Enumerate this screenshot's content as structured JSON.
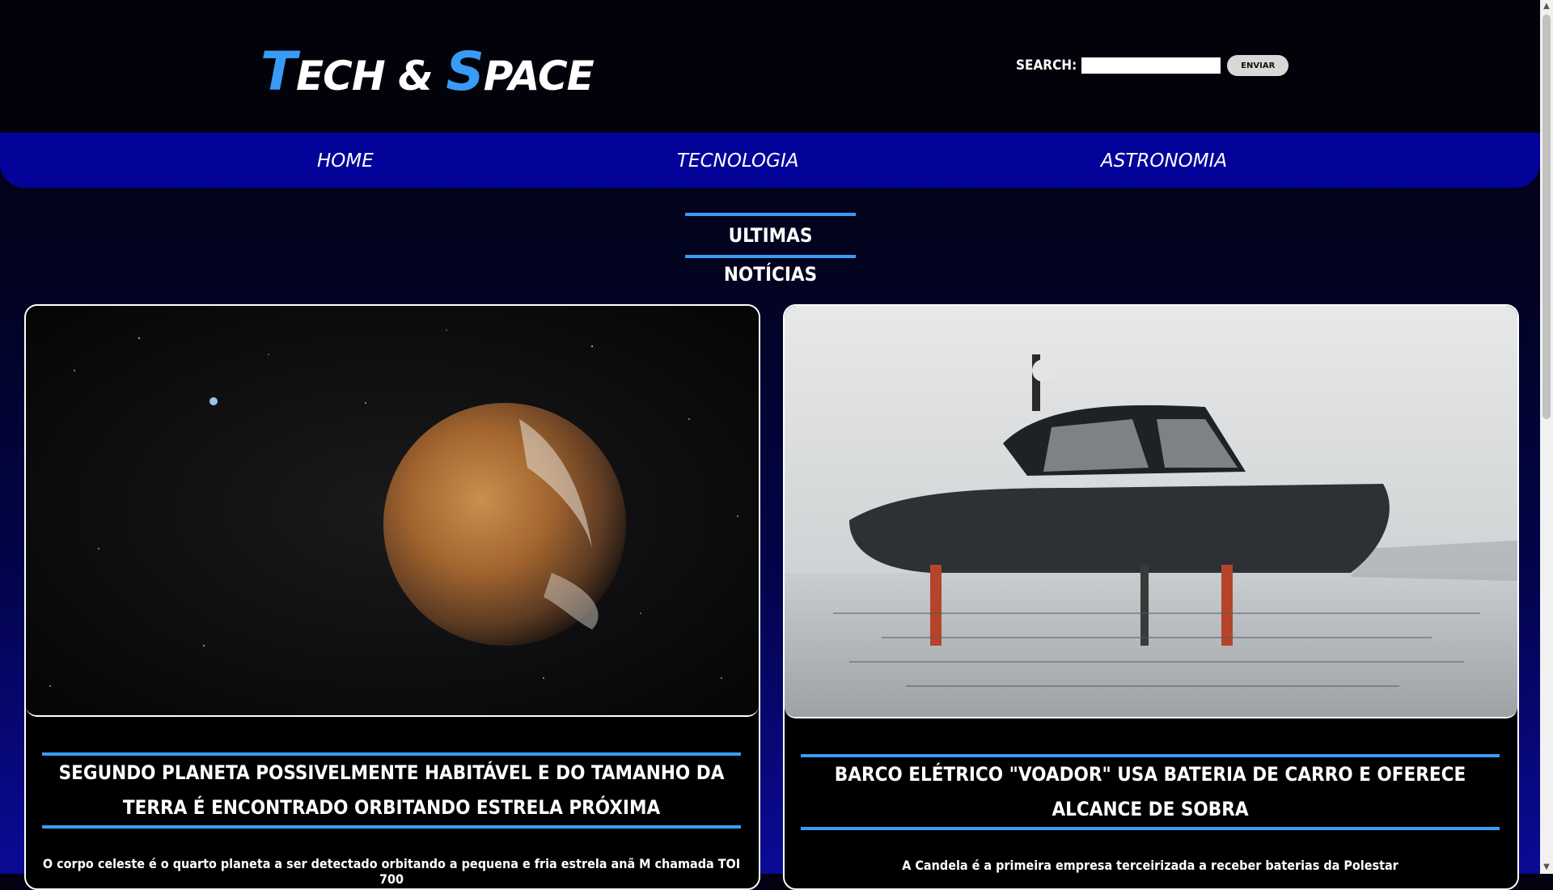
{
  "brand": {
    "logo_t": "T",
    "logo_ech": "ECH",
    "logo_amp": "&",
    "logo_s": "S",
    "logo_pace": "PACE"
  },
  "search": {
    "label": "SEARCH:",
    "placeholder": "",
    "button": "ENVIAR"
  },
  "nav": {
    "items": [
      {
        "label": "HOME"
      },
      {
        "label": "TECNOLOGIA"
      },
      {
        "label": "ASTRONOMIA"
      }
    ]
  },
  "section": {
    "title": "ULTIMAS NOTÍCIAS"
  },
  "articles": [
    {
      "title": "SEGUNDO PLANETA POSSIVELMENTE HABITÁVEL E DO TAMANHO DA TERRA É ENCONTRADO ORBITANDO ESTRELA PRÓXIMA",
      "excerpt": "O corpo celeste é o quarto planeta a ser detectado orbitando a pequena e fria estrela anã M chamada TOI 700"
    },
    {
      "title": "BARCO ELÉTRICO \"VOADOR\" USA BATERIA DE CARRO E OFERECE ALCANCE DE SOBRA",
      "excerpt": "A Candela é a primeira empresa terceirizada a receber baterias da Polestar"
    }
  ],
  "colors": {
    "accent": "#3a9bf5",
    "nav_bg": "#03039a",
    "header_bg": "#02020a"
  }
}
